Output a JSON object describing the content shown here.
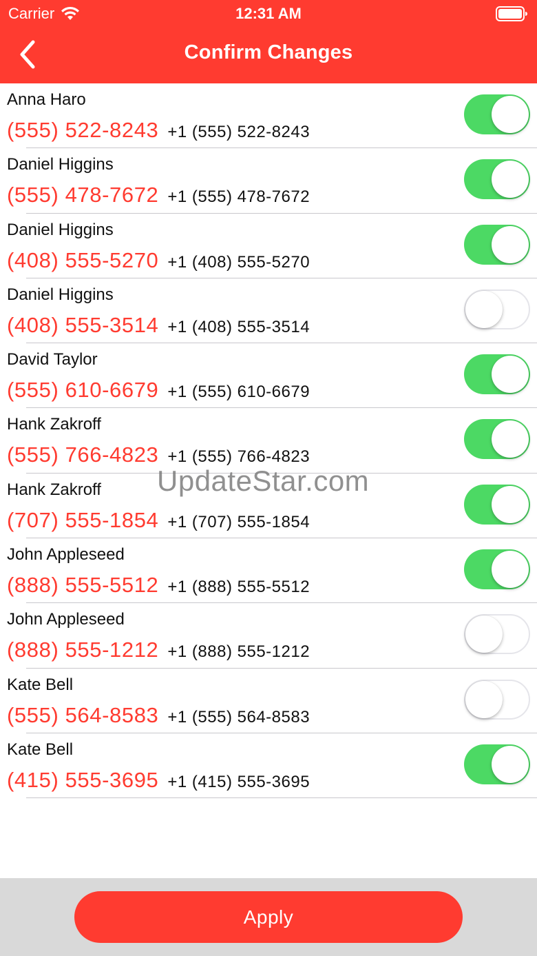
{
  "status_bar": {
    "carrier": "Carrier",
    "time": "12:31 AM",
    "wifi_icon": "wifi-icon",
    "battery_icon": "battery-icon"
  },
  "nav": {
    "title": "Confirm Changes",
    "back_icon": "chevron-left-icon"
  },
  "colors": {
    "accent": "#ff3b30",
    "toggle_on": "#4cd964",
    "bottom_bar": "#d9d9d9"
  },
  "contacts": [
    {
      "name": "Anna Haro",
      "phone": "(555) 522-8243",
      "phone_intl": "+1 (555) 522-8243",
      "enabled": true
    },
    {
      "name": "Daniel Higgins",
      "phone": "(555) 478-7672",
      "phone_intl": "+1 (555) 478-7672",
      "enabled": true
    },
    {
      "name": "Daniel Higgins",
      "phone": "(408) 555-5270",
      "phone_intl": "+1 (408) 555-5270",
      "enabled": true
    },
    {
      "name": "Daniel Higgins",
      "phone": "(408) 555-3514",
      "phone_intl": "+1 (408) 555-3514",
      "enabled": false
    },
    {
      "name": "David Taylor",
      "phone": "(555) 610-6679",
      "phone_intl": "+1 (555) 610-6679",
      "enabled": true
    },
    {
      "name": "Hank Zakroff",
      "phone": "(555) 766-4823",
      "phone_intl": "+1 (555) 766-4823",
      "enabled": true
    },
    {
      "name": "Hank Zakroff",
      "phone": "(707) 555-1854",
      "phone_intl": "+1 (707) 555-1854",
      "enabled": true
    },
    {
      "name": "John Appleseed",
      "phone": "(888) 555-5512",
      "phone_intl": "+1 (888) 555-5512",
      "enabled": true
    },
    {
      "name": "John Appleseed",
      "phone": "(888) 555-1212",
      "phone_intl": "+1 (888) 555-1212",
      "enabled": false
    },
    {
      "name": "Kate Bell",
      "phone": "(555) 564-8583",
      "phone_intl": "+1 (555) 564-8583",
      "enabled": false
    },
    {
      "name": "Kate Bell",
      "phone": "(415) 555-3695",
      "phone_intl": "+1 (415) 555-3695",
      "enabled": true
    }
  ],
  "watermark": "UpdateStar.com",
  "footer": {
    "apply_label": "Apply"
  }
}
